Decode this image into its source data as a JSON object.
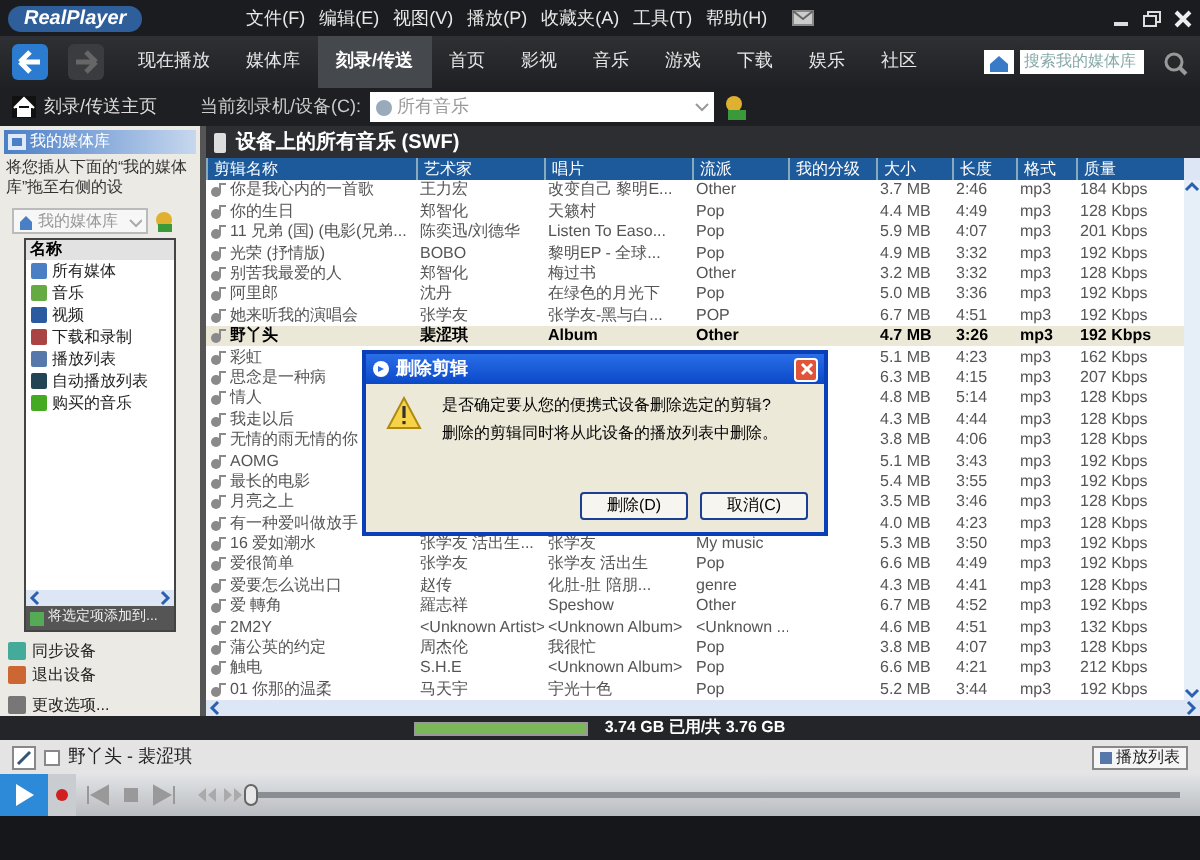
{
  "window": {
    "logo": "RealPlayer",
    "menu": [
      "文件(F)",
      "编辑(E)",
      "视图(V)",
      "播放(P)",
      "收藏夹(A)",
      "工具(T)",
      "帮助(H)"
    ]
  },
  "nav_tabs": [
    {
      "label": "现在播放",
      "selected": false
    },
    {
      "label": "媒体库",
      "selected": false
    },
    {
      "label": "刻录/传送",
      "selected": true
    },
    {
      "label": "首页",
      "selected": false
    },
    {
      "label": "影视",
      "selected": false
    },
    {
      "label": "音乐",
      "selected": false
    },
    {
      "label": "游戏",
      "selected": false
    },
    {
      "label": "下载",
      "selected": false
    },
    {
      "label": "娱乐",
      "selected": false
    },
    {
      "label": "社区",
      "selected": false
    }
  ],
  "search": {
    "placeholder": "搜索我的媒体库"
  },
  "sub_bar": {
    "home": "刻录/传送主页",
    "device_label": "当前刻录机/设备(C):",
    "device_value": "所有音乐"
  },
  "sidebar": {
    "title": "我的媒体库",
    "hint": "将您插从下面的“我的媒体库”拖至右侧的设",
    "source": "我的媒体库",
    "list_header": "名称",
    "items": [
      {
        "label": "所有媒体"
      },
      {
        "label": "音乐"
      },
      {
        "label": "视频"
      },
      {
        "label": "下载和录制"
      },
      {
        "label": "播放列表"
      },
      {
        "label": "自动播放列表"
      },
      {
        "label": "购买的音乐"
      }
    ],
    "add_button": "将选定项添加到...",
    "actions": [
      "同步设备",
      "退出设备",
      "更改选项..."
    ]
  },
  "table": {
    "title": "设备上的所有音乐 (SWF)",
    "columns": [
      "剪辑名称",
      "艺术家",
      "唱片",
      "流派",
      "我的分级",
      "大小",
      "长度",
      "格式",
      "质量"
    ],
    "rows": [
      {
        "name": "你是我心内的一首歌",
        "artist": "王力宏",
        "album": "改变自己 黎明E...",
        "genre": "Other",
        "size": "3.7 MB",
        "length": "2:46",
        "format": "mp3",
        "quality": "184 Kbps",
        "selected": false
      },
      {
        "name": "你的生日",
        "artist": "郑智化",
        "album": "天籁村",
        "genre": "Pop",
        "size": "4.4 MB",
        "length": "4:49",
        "format": "mp3",
        "quality": "128 Kbps",
        "selected": false
      },
      {
        "name": "11 兄弟 (国) (电影(兄弟...",
        "artist": "陈奕迅/刘德华",
        "album": "Listen To Easo...",
        "genre": "Pop",
        "size": "5.9 MB",
        "length": "4:07",
        "format": "mp3",
        "quality": "201 Kbps",
        "selected": false
      },
      {
        "name": "光荣 (抒情版)",
        "artist": "BOBO",
        "album": "黎明EP - 全球...",
        "genre": "Pop",
        "size": "4.9 MB",
        "length": "3:32",
        "format": "mp3",
        "quality": "192 Kbps",
        "selected": false
      },
      {
        "name": "别苦我最爱的人",
        "artist": "郑智化",
        "album": "梅过书",
        "genre": "Other",
        "size": "3.2 MB",
        "length": "3:32",
        "format": "mp3",
        "quality": "128 Kbps",
        "selected": false
      },
      {
        "name": "阿里郎",
        "artist": "沈丹",
        "album": "在绿色的月光下",
        "genre": "Pop",
        "size": "5.0 MB",
        "length": "3:36",
        "format": "mp3",
        "quality": "192 Kbps",
        "selected": false
      },
      {
        "name": "她来听我的演唱会",
        "artist": "张学友",
        "album": "张学友-黑与白...",
        "genre": "POP",
        "size": "6.7 MB",
        "length": "4:51",
        "format": "mp3",
        "quality": "192 Kbps",
        "selected": false
      },
      {
        "name": "野丫头",
        "artist": "裴涩琪",
        "album": "Album",
        "genre": "Other",
        "size": "4.7 MB",
        "length": "3:26",
        "format": "mp3",
        "quality": "192 Kbps",
        "selected": true
      },
      {
        "name": "彩虹",
        "size": "5.1 MB",
        "length": "4:23",
        "format": "mp3",
        "quality": "162 Kbps",
        "selected": false
      },
      {
        "name": "思念是一种病",
        "size": "6.3 MB",
        "length": "4:15",
        "format": "mp3",
        "quality": "207 Kbps",
        "selected": false
      },
      {
        "name": "情人",
        "size": "4.8 MB",
        "length": "5:14",
        "format": "mp3",
        "quality": "128 Kbps",
        "selected": false
      },
      {
        "name": "我走以后",
        "size": "4.3 MB",
        "length": "4:44",
        "format": "mp3",
        "quality": "128 Kbps",
        "selected": false
      },
      {
        "name": "无情的雨无情的你",
        "size": "3.8 MB",
        "length": "4:06",
        "format": "mp3",
        "quality": "128 Kbps",
        "selected": false
      },
      {
        "name": "AOMG",
        "size": "5.1 MB",
        "length": "3:43",
        "format": "mp3",
        "quality": "192 Kbps",
        "selected": false
      },
      {
        "name": "最长的电影",
        "size": "5.4 MB",
        "length": "3:55",
        "format": "mp3",
        "quality": "192 Kbps",
        "selected": false
      },
      {
        "name": "月亮之上",
        "size": "3.5 MB",
        "length": "3:46",
        "format": "mp3",
        "quality": "128 Kbps",
        "selected": false
      },
      {
        "name": "有一种爱叫做放手",
        "size": "4.0 MB",
        "length": "4:23",
        "format": "mp3",
        "quality": "128 Kbps",
        "selected": false
      },
      {
        "name": "16 爱如潮水",
        "artist": "张学友 活出生...",
        "album": "张学友",
        "genre": "My music",
        "size": "5.3 MB",
        "length": "3:50",
        "format": "mp3",
        "quality": "192 Kbps",
        "selected": false
      },
      {
        "name": "爱很简单",
        "artist": "张学友",
        "album": "张学友 活出生",
        "genre": "Pop",
        "size": "6.6 MB",
        "length": "4:49",
        "format": "mp3",
        "quality": "192 Kbps",
        "selected": false
      },
      {
        "name": "爱要怎么说出口",
        "artist": "赵传",
        "album": "化肚-肚 陪朋...",
        "genre": "genre",
        "size": "4.3 MB",
        "length": "4:41",
        "format": "mp3",
        "quality": "128 Kbps",
        "selected": false
      },
      {
        "name": "爱 轉角",
        "artist": "羅志祥",
        "album": "Speshow",
        "genre": "Other",
        "size": "6.7 MB",
        "length": "4:52",
        "format": "mp3",
        "quality": "192 Kbps",
        "selected": false
      },
      {
        "name": "2M2Y",
        "artist": "<Unknown Artist>",
        "album": "<Unknown Album>",
        "genre": "<Unknown ...",
        "size": "4.6 MB",
        "length": "4:51",
        "format": "mp3",
        "quality": "132 Kbps",
        "selected": false
      },
      {
        "name": "蒲公英的约定",
        "artist": "周杰伦",
        "album": "我很忙",
        "genre": "Pop",
        "size": "3.8 MB",
        "length": "4:07",
        "format": "mp3",
        "quality": "128 Kbps",
        "selected": false
      },
      {
        "name": "触电",
        "artist": "S.H.E",
        "album": "<Unknown Album>",
        "genre": "Pop",
        "size": "6.6 MB",
        "length": "4:21",
        "format": "mp3",
        "quality": "212 Kbps",
        "selected": false
      },
      {
        "name": "01 你那的温柔",
        "artist": "马天宇",
        "album": "宇光十色",
        "genre": "Pop",
        "size": "5.2 MB",
        "length": "3:44",
        "format": "mp3",
        "quality": "192 Kbps",
        "selected": false
      }
    ]
  },
  "dialog": {
    "title": "删除剪辑",
    "message": "是否确定要从您的便携式设备删除选定的剪辑?",
    "note": "删除的剪辑同时将从此设备的播放列表中删除。",
    "buttons": [
      "删除(D)",
      "取消(C)"
    ]
  },
  "storage": {
    "level": 0.99,
    "text": "3.74 GB 已用/共 3.76 GB"
  },
  "now_playing": {
    "title": "野丫头 - 裴涩琪",
    "playlist_button": "播放列表"
  },
  "transport": {
    "seek": {
      "level": 0
    }
  }
}
